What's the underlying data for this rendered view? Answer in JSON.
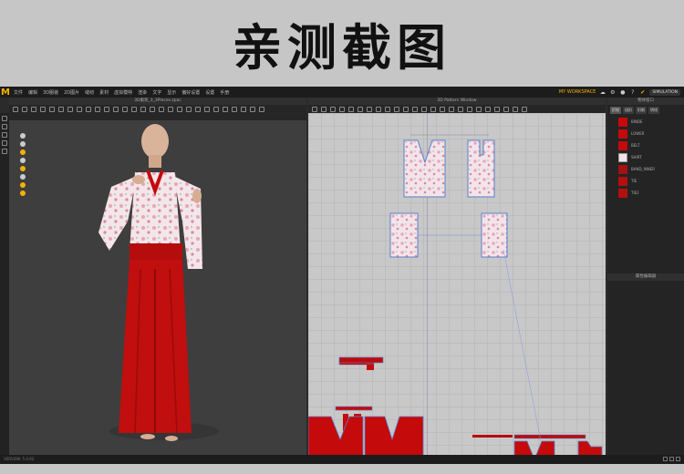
{
  "banner": {
    "title": "亲测截图"
  },
  "menubar": {
    "logo": "M",
    "items": [
      "文件",
      "编辑",
      "3D服装",
      "2D图片",
      "缝纫",
      "素材",
      "虚拟模特",
      "渲染",
      "文字",
      "显示",
      "偏好设置",
      "设置",
      "手册"
    ],
    "workspace": "MY WORKSPACE",
    "mode": "SIMULATION"
  },
  "view3d": {
    "title": "3D服装_3_3Pieces.zpac"
  },
  "view2d": {
    "title": "2D Pattern Window"
  },
  "rpanel": {
    "title": "物体窗口",
    "tabs": [
      "织物",
      "纽扣",
      "扣眼",
      "明线"
    ],
    "fabrics": [
      {
        "label": "BINDE",
        "color": "#c40a0a"
      },
      {
        "label": "LOWER",
        "color": "#c40a0a"
      },
      {
        "label": "BELT",
        "color": "#c40a0a"
      },
      {
        "label": "SHIRT",
        "color": "#f1e4e6"
      },
      {
        "label": "BAND_INNER",
        "color": "#a51010"
      },
      {
        "label": "TIE",
        "color": "#b30f0f"
      },
      {
        "label": "TIE2",
        "color": "#b30f0f"
      }
    ],
    "props_title": "属性编辑器"
  },
  "status": {
    "text": "VERSION: 5.0.92"
  },
  "icons": [
    "add-icon",
    "clone-icon",
    "search-icon",
    "gear-icon",
    "user-icon",
    "help-icon",
    "expand-icon"
  ]
}
